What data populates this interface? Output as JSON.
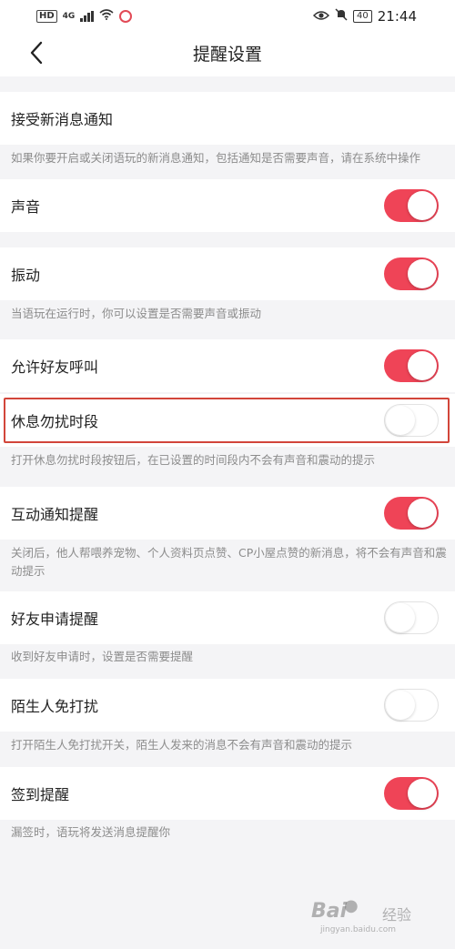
{
  "statusbar": {
    "left": {
      "hd": "HD",
      "network": "4G"
    },
    "right": {
      "battery": "40",
      "time": "21:44"
    }
  },
  "navbar": {
    "title": "提醒设置"
  },
  "rows": [
    {
      "label": "接受新消息通知"
    },
    {
      "label": "声音",
      "toggle": "on"
    },
    {
      "label": "振动",
      "toggle": "on"
    },
    {
      "label": "允许好友呼叫",
      "toggle": "on"
    },
    {
      "label": "休息勿扰时段",
      "toggle": "off"
    },
    {
      "label": "互动通知提醒",
      "toggle": "on"
    },
    {
      "label": "好友申请提醒",
      "toggle": "off"
    },
    {
      "label": "陌生人免打扰",
      "toggle": "off"
    },
    {
      "label": "签到提醒",
      "toggle": "on"
    }
  ],
  "descriptions": {
    "new_message": "如果你要开启或关闭语玩的新消息通知，包括通知是否需要声音，请在系统中操作",
    "vibration": "当语玩在运行时，你可以设置是否需要声音或振动",
    "dnd": "打开休息勿扰时段按钮后，在已设置的时间段内不会有声音和震动的提示",
    "interaction": "关闭后，他人帮喂养宠物、个人资料页点赞、CP小屋点赞的新消息，将不会有声音和震动提示",
    "friend_request": "收到好友申请时，设置是否需要提醒",
    "stranger": "打开陌生人免打扰开关，陌生人发来的消息不会有声音和震动的提示",
    "checkin": "漏签时，语玩将发送消息提醒你"
  },
  "colors": {
    "accent": "#ef4457",
    "highlight_border": "#d2453a",
    "background": "#f4f4f6",
    "description_text": "#8c8c8c"
  },
  "icons": {
    "back": "chevron-left-icon",
    "eye": "eye-icon",
    "mute": "bell-off-icon",
    "wifi": "wifi-icon"
  },
  "watermark": {
    "logo": "Bai",
    "site": "经验",
    "url": "jingyan.baidu.com"
  }
}
